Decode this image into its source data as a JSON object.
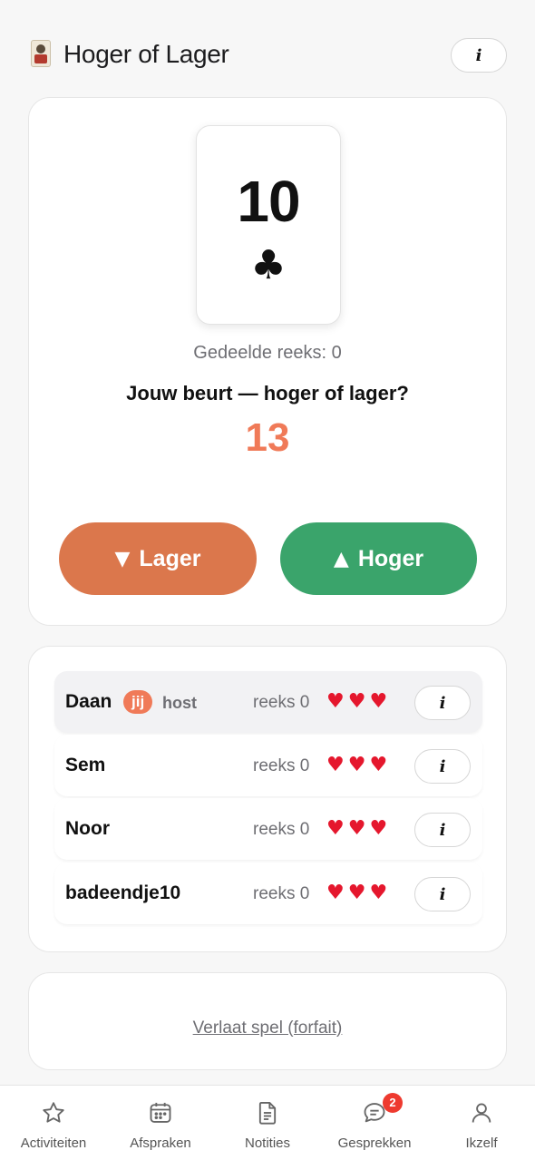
{
  "header": {
    "title": "Hoger of Lager",
    "info_label": "i",
    "icon": "jester-card-icon"
  },
  "game": {
    "card_rank": "10",
    "card_suit": "♣",
    "card_suit_name": "clubs",
    "shared_streak": "Gedeelde reeks: 0",
    "turn_prompt": "Jouw beurt — hoger of lager?",
    "timer": "13",
    "timer_color": "#f07a58",
    "lower_arrow": "▼",
    "lower_label": "Lager",
    "lower_color": "#db774c",
    "higher_arrow": "▲",
    "higher_label": "Hoger",
    "higher_color": "#3aa46b"
  },
  "players": [
    {
      "name": "Daan",
      "badge": "jij",
      "role": "host",
      "streak": "reeks 0",
      "lives": 3,
      "hearts": "♥",
      "info": "i",
      "active": true
    },
    {
      "name": "Sem",
      "streak": "reeks 0",
      "lives": 3,
      "hearts": "♥",
      "info": "i"
    },
    {
      "name": "Noor",
      "streak": "reeks 0",
      "lives": 3,
      "hearts": "♥",
      "info": "i"
    },
    {
      "name": "badeendje10",
      "streak": "reeks 0",
      "lives": 3,
      "hearts": "♥",
      "info": "i"
    }
  ],
  "leave": {
    "label": "Verlaat spel (forfait)"
  },
  "tabbar": {
    "tabs": [
      {
        "label": "Activiteiten",
        "icon": "star-icon"
      },
      {
        "label": "Afspraken",
        "icon": "calendar-icon"
      },
      {
        "label": "Notities",
        "icon": "document-icon"
      },
      {
        "label": "Gesprekken",
        "icon": "chat-icon",
        "badge": "2"
      },
      {
        "label": "Ikzelf",
        "icon": "person-icon"
      }
    ]
  }
}
